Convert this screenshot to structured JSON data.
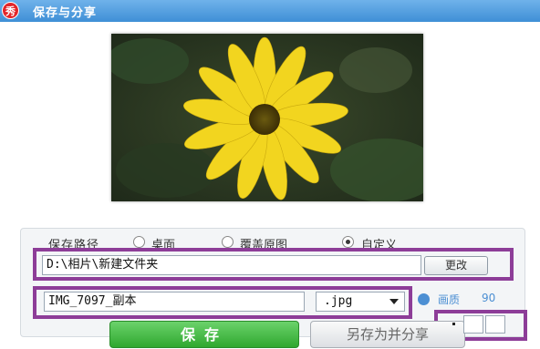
{
  "window": {
    "title": "保存与分享",
    "logo_text": "秀"
  },
  "photo": {
    "description_icon": "sunflower-photo"
  },
  "save_path": {
    "label": "保存路径",
    "options": [
      {
        "label": "桌面",
        "checked": false
      },
      {
        "label": "覆盖原图",
        "checked": false
      },
      {
        "label": "自定义",
        "checked": true
      }
    ],
    "value": "D:\\相片\\新建文件夹",
    "change_button": "更改"
  },
  "file": {
    "name": "IMG_7097_副本",
    "extension": ".jpg",
    "quality_label": "画质",
    "quality_value": "90"
  },
  "buttons": {
    "save": "保存",
    "save_as": "另存为并分享"
  },
  "colors": {
    "titlebar": "#4a96dc",
    "highlight": "#8d3d98",
    "save_green": "#3fb63f",
    "link_blue": "#4c8fd3"
  }
}
